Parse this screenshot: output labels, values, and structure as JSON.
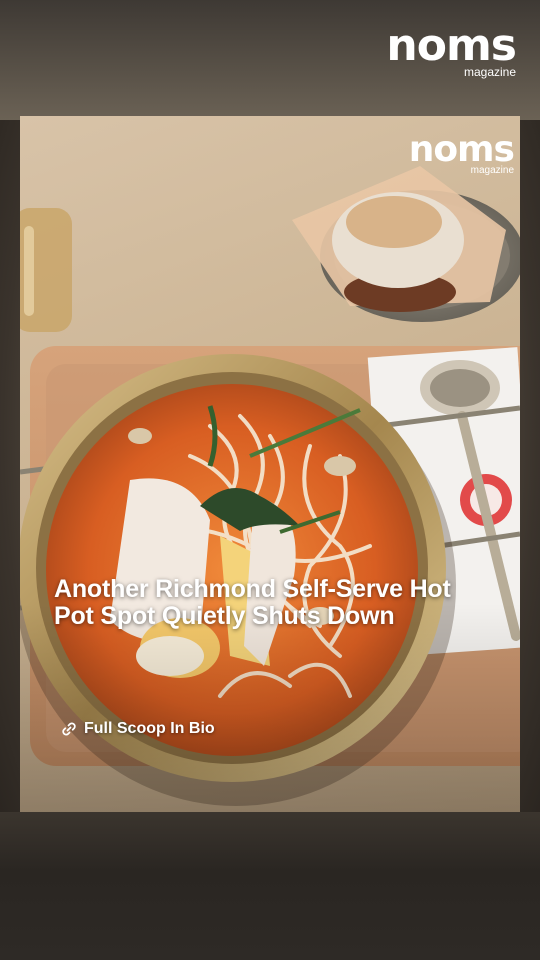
{
  "brand": {
    "name": "noms",
    "sub": "magazine"
  },
  "post": {
    "headline": "Another Richmond Self-Serve Hot Pot Spot Quietly Shuts Down",
    "cta": "Full Scoop In Bio",
    "cta_icon": "link-icon"
  },
  "colors": {
    "text": "#ffffff",
    "broth": "#e06a2a",
    "pot": "#b89a5e",
    "table": "#cdb696"
  }
}
